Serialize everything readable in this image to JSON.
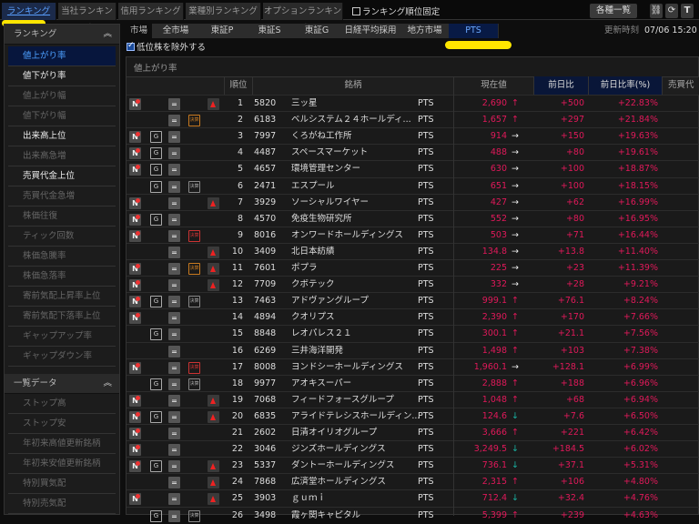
{
  "top_tabs": [
    {
      "label": "ランキング",
      "active": true
    },
    {
      "label": "当社ランキング"
    },
    {
      "label": "信用ランキング"
    },
    {
      "label": "業種別ランキング"
    },
    {
      "label": "オプションランキング"
    }
  ],
  "fix_rank_label": "ランキング順位固定",
  "list_button": "各種一覧",
  "toolbar_icons": [
    "link-icon",
    "refresh-icon",
    "text-icon"
  ],
  "toolbar_T": "T",
  "sidebar": {
    "section1": {
      "title": "ランキング",
      "items": [
        {
          "label": "値上がり率",
          "state": "active"
        },
        {
          "label": "値下がり率",
          "state": "bright"
        },
        {
          "label": "値上がり幅",
          "state": "dim"
        },
        {
          "label": "値下がり幅",
          "state": "dim"
        },
        {
          "label": "出来高上位",
          "state": "bright"
        },
        {
          "label": "出来高急増",
          "state": "dim"
        },
        {
          "label": "売買代金上位",
          "state": "bright"
        },
        {
          "label": "売買代金急増",
          "state": "dim"
        },
        {
          "label": "株価往復",
          "state": "dim"
        },
        {
          "label": "ティック回数",
          "state": "dim"
        },
        {
          "label": "株価急騰率",
          "state": "dim"
        },
        {
          "label": "株価急落率",
          "state": "dim"
        },
        {
          "label": "寄前気配上昇率上位",
          "state": "dim"
        },
        {
          "label": "寄前気配下落率上位",
          "state": "dim"
        },
        {
          "label": "ギャップアップ率",
          "state": "dim"
        },
        {
          "label": "ギャップダウン率",
          "state": "dim"
        }
      ]
    },
    "section2": {
      "title": "一覧データ",
      "items": [
        {
          "label": "ストップ高",
          "state": "dim"
        },
        {
          "label": "ストップ安",
          "state": "dim"
        },
        {
          "label": "年初来高値更新銘柄",
          "state": "dim"
        },
        {
          "label": "年初来安値更新銘柄",
          "state": "dim"
        },
        {
          "label": "特別買気配",
          "state": "dim"
        },
        {
          "label": "特別売気配",
          "state": "dim"
        }
      ]
    }
  },
  "market": {
    "label": "市場",
    "tabs": [
      "全市場",
      "東証P",
      "東証S",
      "東証G",
      "日経平均採用",
      "地方市場",
      "PTS"
    ],
    "selected": "PTS"
  },
  "update": {
    "label": "更新時刻",
    "value": "07/06 15:20"
  },
  "exclude_low": {
    "label": "低位株を除外する",
    "checked": true
  },
  "table": {
    "title": "値上がり率",
    "headers": {
      "rank": "順位",
      "name": "銘柄",
      "price": "現在値",
      "change": "前日比",
      "pct": "前日比率(%)",
      "trade": "売買代"
    },
    "kessan_label": "決算",
    "g_label": "G",
    "n_label": "N",
    "eq_label": "=",
    "rows": [
      {
        "rank": "1",
        "code": "5820",
        "name": "三ッ星",
        "market": "PTS",
        "price": "2,690",
        "arrow": "up",
        "change": "+500",
        "pct": "+22.83%",
        "n": true,
        "g": false,
        "k": null,
        "warn": true
      },
      {
        "rank": "2",
        "code": "6183",
        "name": "ベルシステム２４ホールディ...",
        "market": "PTS",
        "price": "1,657",
        "arrow": "up",
        "change": "+297",
        "pct": "+21.84%",
        "n": false,
        "g": false,
        "k": "orange",
        "warn": false
      },
      {
        "rank": "3",
        "code": "7997",
        "name": "くろがね工作所",
        "market": "PTS",
        "price": "914",
        "arrow": "right",
        "change": "+150",
        "pct": "+19.63%",
        "n": true,
        "g": true,
        "k": null,
        "warn": false
      },
      {
        "rank": "4",
        "code": "4487",
        "name": "スペースマーケット",
        "market": "PTS",
        "price": "488",
        "arrow": "right",
        "change": "+80",
        "pct": "+19.61%",
        "n": true,
        "g": true,
        "k": null,
        "warn": false
      },
      {
        "rank": "5",
        "code": "4657",
        "name": "環境管理センター",
        "market": "PTS",
        "price": "630",
        "arrow": "right",
        "change": "+100",
        "pct": "+18.87%",
        "n": true,
        "g": true,
        "k": null,
        "warn": false
      },
      {
        "rank": "6",
        "code": "2471",
        "name": "エスプール",
        "market": "PTS",
        "price": "651",
        "arrow": "right",
        "change": "+100",
        "pct": "+18.15%",
        "n": false,
        "g": true,
        "k": "gray",
        "warn": false
      },
      {
        "rank": "7",
        "code": "3929",
        "name": "ソーシャルワイヤー",
        "market": "PTS",
        "price": "427",
        "arrow": "right",
        "change": "+62",
        "pct": "+16.99%",
        "n": true,
        "g": false,
        "k": null,
        "warn": true
      },
      {
        "rank": "8",
        "code": "4570",
        "name": "免疫生物研究所",
        "market": "PTS",
        "price": "552",
        "arrow": "right",
        "change": "+80",
        "pct": "+16.95%",
        "n": true,
        "g": true,
        "k": null,
        "warn": false
      },
      {
        "rank": "9",
        "code": "8016",
        "name": "オンワードホールディングス",
        "market": "PTS",
        "price": "503",
        "arrow": "right",
        "change": "+71",
        "pct": "+16.44%",
        "n": true,
        "g": false,
        "k": "red",
        "warn": false
      },
      {
        "rank": "10",
        "code": "3409",
        "name": "北日本紡績",
        "market": "PTS",
        "price": "134.8",
        "arrow": "right",
        "change": "+13.8",
        "pct": "+11.40%",
        "n": false,
        "g": false,
        "k": null,
        "warn": true
      },
      {
        "rank": "11",
        "code": "7601",
        "name": "ポプラ",
        "market": "PTS",
        "price": "225",
        "arrow": "right",
        "change": "+23",
        "pct": "+11.39%",
        "n": true,
        "g": false,
        "k": "orange",
        "warn": true
      },
      {
        "rank": "12",
        "code": "7709",
        "name": "クボテック",
        "market": "PTS",
        "price": "332",
        "arrow": "right",
        "change": "+28",
        "pct": "+9.21%",
        "n": true,
        "g": false,
        "k": null,
        "warn": true
      },
      {
        "rank": "13",
        "code": "7463",
        "name": "アドヴァングループ",
        "market": "PTS",
        "price": "999.1",
        "arrow": "up",
        "change": "+76.1",
        "pct": "+8.24%",
        "n": true,
        "g": true,
        "k": "gray",
        "warn": false
      },
      {
        "rank": "14",
        "code": "4894",
        "name": "クオリプス",
        "market": "PTS",
        "price": "2,390",
        "arrow": "up",
        "change": "+170",
        "pct": "+7.66%",
        "n": true,
        "g": false,
        "k": null,
        "warn": false
      },
      {
        "rank": "15",
        "code": "8848",
        "name": "レオパレス２１",
        "market": "PTS",
        "price": "300.1",
        "arrow": "up",
        "change": "+21.1",
        "pct": "+7.56%",
        "n": false,
        "g": true,
        "k": null,
        "warn": false
      },
      {
        "rank": "16",
        "code": "6269",
        "name": "三井海洋開発",
        "market": "PTS",
        "price": "1,498",
        "arrow": "up",
        "change": "+103",
        "pct": "+7.38%",
        "n": false,
        "g": false,
        "k": null,
        "warn": false
      },
      {
        "rank": "17",
        "code": "8008",
        "name": "ヨンドシーホールディングス",
        "market": "PTS",
        "price": "1,960.1",
        "arrow": "right",
        "change": "+128.1",
        "pct": "+6.99%",
        "n": true,
        "g": false,
        "k": "red",
        "warn": false
      },
      {
        "rank": "18",
        "code": "9977",
        "name": "アオキスーパー",
        "market": "PTS",
        "price": "2,888",
        "arrow": "up",
        "change": "+188",
        "pct": "+6.96%",
        "n": false,
        "g": true,
        "k": "gray",
        "warn": false
      },
      {
        "rank": "19",
        "code": "7068",
        "name": "フィードフォースグループ",
        "market": "PTS",
        "price": "1,048",
        "arrow": "up",
        "change": "+68",
        "pct": "+6.94%",
        "n": true,
        "g": false,
        "k": null,
        "warn": true
      },
      {
        "rank": "20",
        "code": "6835",
        "name": "アライドテレシスホールディン...",
        "market": "PTS",
        "price": "124.6",
        "arrow": "down",
        "change": "+7.6",
        "pct": "+6.50%",
        "n": true,
        "g": true,
        "k": null,
        "warn": true
      },
      {
        "rank": "21",
        "code": "2602",
        "name": "日清オイリオグループ",
        "market": "PTS",
        "price": "3,666",
        "arrow": "up",
        "change": "+221",
        "pct": "+6.42%",
        "n": true,
        "g": false,
        "k": null,
        "warn": false
      },
      {
        "rank": "22",
        "code": "3046",
        "name": "ジンズホールディングス",
        "market": "PTS",
        "price": "3,249.5",
        "arrow": "down",
        "change": "+184.5",
        "pct": "+6.02%",
        "n": true,
        "g": false,
        "k": null,
        "warn": false
      },
      {
        "rank": "23",
        "code": "5337",
        "name": "ダントーホールディングス",
        "market": "PTS",
        "price": "736.1",
        "arrow": "down",
        "change": "+37.1",
        "pct": "+5.31%",
        "n": true,
        "g": true,
        "k": null,
        "warn": true
      },
      {
        "rank": "24",
        "code": "7868",
        "name": "広済堂ホールディングス",
        "market": "PTS",
        "price": "2,315",
        "arrow": "up",
        "change": "+106",
        "pct": "+4.80%",
        "n": false,
        "g": false,
        "k": null,
        "warn": true
      },
      {
        "rank": "25",
        "code": "3903",
        "name": "ｇｕｍｉ",
        "market": "PTS",
        "price": "712.4",
        "arrow": "down",
        "change": "+32.4",
        "pct": "+4.76%",
        "n": true,
        "g": false,
        "k": null,
        "warn": true
      },
      {
        "rank": "26",
        "code": "3498",
        "name": "霞ヶ関キャピタル",
        "market": "PTS",
        "price": "5,399",
        "arrow": "up",
        "change": "+239",
        "pct": "+4.63%",
        "n": false,
        "g": true,
        "k": "gray",
        "warn": false
      }
    ]
  },
  "colors": {
    "positive": "#e0195a",
    "down_arrow": "#19b0a0",
    "selected_tab": "#081a45",
    "highlight": "#ffe600"
  }
}
